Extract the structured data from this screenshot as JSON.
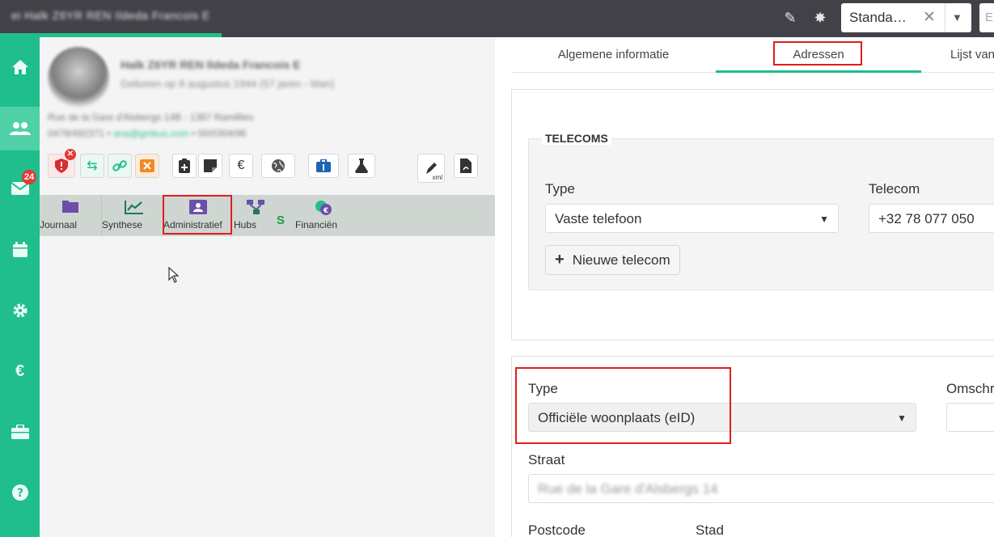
{
  "topbar": {
    "title": "ei Halk Z6YR REN Ildeda Francois E",
    "combo_value": "Standa…",
    "combo_clear": "✕",
    "combo_arrow": "▼",
    "combo2_value": "E",
    "icons": [
      "syringe-icon",
      "virus-icon"
    ]
  },
  "nav": {
    "items": [
      "home-icon",
      "users-icon",
      "mail-icon",
      "calendar-icon",
      "gear-icon",
      "euro-icon",
      "toolbox-icon",
      "help-icon"
    ],
    "mail_badge": "24"
  },
  "patient": {
    "name": "Halk Z6YR REN Ildeda Francois E",
    "subname": "Geboren op 8 augustus 1944 (57 jaren - Man)",
    "address": "Rue de la Gare d'Alsbergs 14B - 1367 Ramillies",
    "phone": "0479/492371",
    "email": "ana@gmkus.com",
    "ref": "00/0304/96"
  },
  "toolbar": {
    "euro": "€",
    "xml_label": "xml"
  },
  "subtabs": [
    {
      "label": "Journaal"
    },
    {
      "label": "Synthese"
    },
    {
      "label": "Administratief"
    },
    {
      "label": "Hubs",
      "status": "S"
    },
    {
      "label": "Financiën"
    }
  ],
  "tabs": [
    {
      "label": "Algemene informatie"
    },
    {
      "label": "Adressen"
    },
    {
      "label": "Lijst van"
    }
  ],
  "telecoms": {
    "legend": "TELECOMS",
    "type_label": "Type",
    "type_value": "Vaste telefoon",
    "telecom_label": "Telecom",
    "telecom_value": "+32 78 077 050",
    "add_button": "Nieuwe telecom"
  },
  "address": {
    "type_label": "Type",
    "type_value": "Officiële woonplaats (eID)",
    "omschr_label": "Omschr",
    "straat_label": "Straat",
    "straat_value": "Rue de la Gare d'Alsbergs 14",
    "postcode_label": "Postcode",
    "stad_label": "Stad"
  },
  "colors": {
    "accent": "#1fbe8c",
    "topbar": "#424148",
    "highlight": "#e01e1e"
  }
}
